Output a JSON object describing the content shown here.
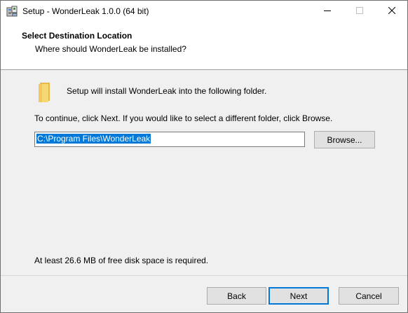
{
  "window": {
    "title": "Setup - WonderLeak 1.0.0 (64 bit)",
    "app_icon": "installer-icon",
    "controls": {
      "minimize_icon": "minimize-icon",
      "maximize_icon": "maximize-icon",
      "close_icon": "close-icon"
    }
  },
  "header": {
    "title": "Select Destination Location",
    "subtitle": "Where should WonderLeak be installed?"
  },
  "body": {
    "folder_icon": "folder-icon",
    "intro": "Setup will install WonderLeak into the following folder.",
    "instruction": "To continue, click Next. If you would like to select a different folder, click Browse.",
    "destination_path": "C:\\Program Files\\WonderLeak",
    "browse_label": "Browse...",
    "disk_space": "At least 26.6 MB of free disk space is required."
  },
  "footer": {
    "back_label": "Back",
    "next_label": "Next",
    "cancel_label": "Cancel"
  },
  "colors": {
    "accent": "#0078d7",
    "folder": "#f8d775",
    "button_bg": "#e1e1e1",
    "panel_bg": "#f0f0f0"
  }
}
